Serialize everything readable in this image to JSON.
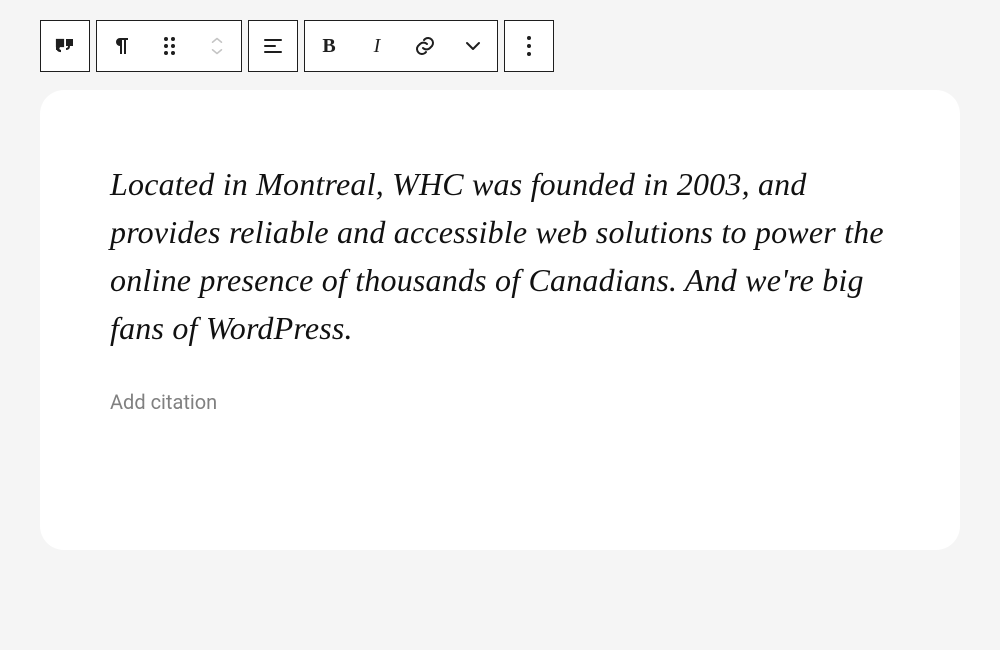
{
  "toolbar": {
    "block_type_label": "Pullquote",
    "bold_glyph": "B",
    "italic_glyph": "I"
  },
  "block": {
    "quote_text": "Located in Montreal, WHC was founded in 2003, and provides reliable and accessible web solutions to power the online presence of thousands of Canadians. And we're big fans of WordPress.",
    "citation_text": "",
    "citation_placeholder": "Add citation"
  }
}
